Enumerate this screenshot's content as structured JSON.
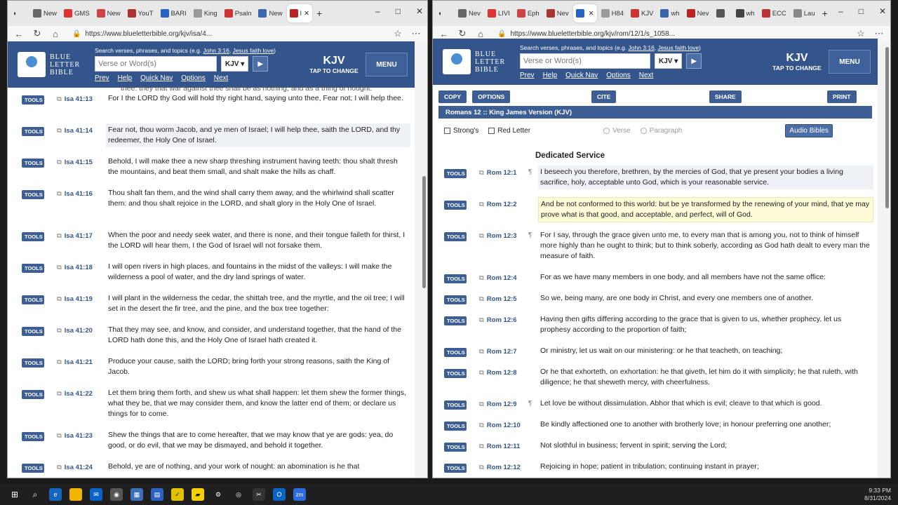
{
  "left": {
    "tabs": [
      "New",
      "GMS",
      "New",
      "YouT",
      "BARI",
      "King",
      "Psaln",
      "New",
      "I"
    ],
    "url": "https://www.blueletterbible.org/kjv/isa/4...",
    "verses": [
      {
        "ref": "Isa 41:13",
        "text": "For I the LORD thy God will hold thy right hand, saying unto thee, Fear not; I will help thee.",
        "hl": ""
      },
      {
        "ref": "Isa 41:14",
        "text": "Fear not, thou worm Jacob, and ye men of Israel; I will help thee, saith the LORD, and thy redeemer, the Holy One of Israel.",
        "hl": "grey"
      },
      {
        "ref": "Isa 41:15",
        "text": "Behold, I will make thee a new sharp threshing instrument having teeth: thou shalt thresh the mountains, and beat them small, and shalt make the hills as chaff.",
        "hl": ""
      },
      {
        "ref": "Isa 41:16",
        "text": "Thou shalt fan them, and the wind shall carry them away, and the whirlwind shall scatter them: and thou shalt rejoice in the LORD, and shalt glory in the Holy One of Israel.",
        "hl": ""
      },
      {
        "ref": "Isa 41:17",
        "text": "When the poor and needy seek water, and there is none, and their tongue faileth for thirst, I the LORD will hear them, I the God of Israel will not forsake them.",
        "hl": ""
      },
      {
        "ref": "Isa 41:18",
        "text": "I will open rivers in high places, and fountains in the midst of the valleys: I will make the wilderness a pool of water, and the dry land springs of water.",
        "hl": ""
      },
      {
        "ref": "Isa 41:19",
        "text": "I will plant in the wilderness the cedar, the shittah tree, and the myrtle, and the oil tree; I will set in the desert the fir tree, and the pine, and the box tree together:",
        "hl": ""
      },
      {
        "ref": "Isa 41:20",
        "text": "That they may see, and know, and consider, and understand together, that the hand of the LORD hath done this, and the Holy One of Israel hath created it.",
        "hl": ""
      },
      {
        "ref": "Isa 41:21",
        "text": "Produce your cause, saith the LORD; bring forth your strong reasons, saith the King of Jacob.",
        "hl": ""
      },
      {
        "ref": "Isa 41:22",
        "text": "Let them bring them forth, and shew us what shall happen: let them shew the former things, what they be, that we may consider them, and know the latter end of them; or declare us things for to come.",
        "hl": ""
      },
      {
        "ref": "Isa 41:23",
        "text": "Shew the things that are to come hereafter, that we may know that ye are gods: yea, do good, or do evil, that we may be dismayed, and behold it together.",
        "hl": ""
      },
      {
        "ref": "Isa 41:24",
        "text": "Behold, ye are of nothing, and your work of nought: an abomination is he that",
        "hl": ""
      }
    ],
    "top_partial": "thee: they that war against thee shall be as nothing, and as a thing of nought."
  },
  "right": {
    "tabs": [
      "Nev",
      "LIVI",
      "Eph",
      "Nev",
      "",
      "H84",
      "KJV",
      "wh",
      "Nev",
      "",
      "wh",
      "ECC",
      "Lau"
    ],
    "url": "https://www.blueletterbible.org/kjv/rom/12/1/s_1058...",
    "actions": {
      "copy": "COPY",
      "options": "OPTIONS",
      "cite": "CITE",
      "share": "SHARE",
      "print": "PRINT"
    },
    "chapter_title": "Romans 12 :: King James Version (KJV)",
    "opt_strongs": "Strong's",
    "opt_redletter": "Red Letter",
    "opt_verse": "Verse",
    "opt_paragraph": "Paragraph",
    "audio": "Audio Bibles",
    "section": "Dedicated Service",
    "verses": [
      {
        "ref": "Rom 12:1",
        "para": "¶",
        "text": "I beseech you therefore, brethren, by the mercies of God, that ye present your bodies a living sacrifice, holy, acceptable unto God, which is your reasonable service.",
        "hl": "grey"
      },
      {
        "ref": "Rom 12:2",
        "para": "",
        "text": "And be not conformed to this world: but be ye transformed by the renewing of your mind, that ye may prove what is that good, and acceptable, and perfect, will of God.",
        "hl": "yellow"
      },
      {
        "ref": "Rom 12:3",
        "para": "¶",
        "text": "For I say, through the grace given unto me, to every man that is among you, not to think of himself more highly than he ought to think; but to think soberly, according as God hath dealt to every man the measure of faith.",
        "hl": ""
      },
      {
        "ref": "Rom 12:4",
        "para": "",
        "text": "For as we have many members in one body, and all members have not the same office:",
        "hl": ""
      },
      {
        "ref": "Rom 12:5",
        "para": "",
        "text": "So we, being many, are one body in Christ, and every one members one of another.",
        "hl": ""
      },
      {
        "ref": "Rom 12:6",
        "para": "",
        "text": "Having then gifts differing according to the grace that is given to us, whether prophecy, let us prophesy according to the proportion of faith;",
        "hl": ""
      },
      {
        "ref": "Rom 12:7",
        "para": "",
        "text": "Or ministry, let us wait on our ministering: or he that teacheth, on teaching;",
        "hl": ""
      },
      {
        "ref": "Rom 12:8",
        "para": "",
        "text": "Or he that exhorteth, on exhortation: he that giveth, let him do it with simplicity; he that ruleth, with diligence; he that sheweth mercy, with cheerfulness.",
        "hl": ""
      },
      {
        "ref": "Rom 12:9",
        "para": "¶",
        "text": "Let love be without dissimulation. Abhor that which is evil; cleave to that which is good.",
        "hl": ""
      },
      {
        "ref": "Rom 12:10",
        "para": "",
        "text": "Be kindly affectioned one to another with brotherly love; in honour preferring one another;",
        "hl": ""
      },
      {
        "ref": "Rom 12:11",
        "para": "",
        "text": "Not slothful in business; fervent in spirit; serving the Lord;",
        "hl": ""
      },
      {
        "ref": "Rom 12:12",
        "para": "",
        "text": "Rejoicing in hope; patient in tribulation; continuing instant in prayer;",
        "hl": ""
      }
    ]
  },
  "blb": {
    "logo_line1": "BLUE",
    "logo_line2": "LETTER",
    "logo_line3": "BIBLE",
    "search_hint": "Search verses, phrases, and topics (e.g. ",
    "search_ex1": "John 3:16",
    "search_ex2": "Jesus faith love",
    "search_placeholder": "Verse or Word(s)",
    "version": "KJV ▾",
    "kjv": "KJV",
    "tap": "TAP TO CHANGE",
    "menu": "MENU",
    "links": [
      "Prev",
      "Help",
      "Quick Nav",
      "Options",
      "Next"
    ],
    "tools": "TOOLS"
  },
  "taskbar": {
    "time": "9:33 PM",
    "date": "8/31/2024"
  }
}
